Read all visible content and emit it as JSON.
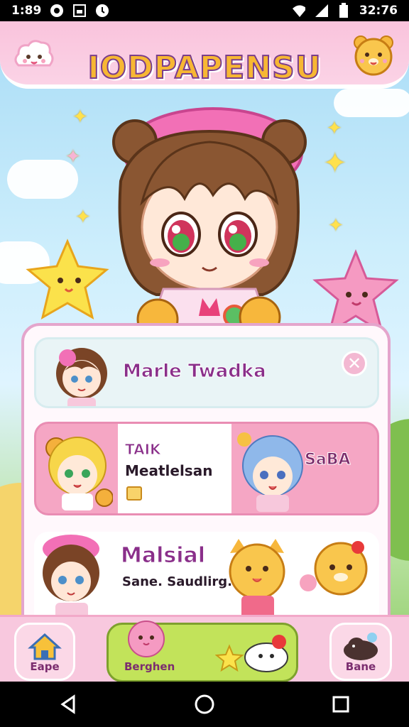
{
  "status_bar": {
    "time_left": "1:89",
    "time_right": "32:76"
  },
  "header": {
    "title": "IODPAPENSU"
  },
  "panel": {
    "row1": {
      "name": "Marle Twadka"
    },
    "row2": {
      "tag": "TAIK",
      "name": "Meatlelsan",
      "right_label": "SaBA"
    },
    "row3": {
      "title": "Malsial",
      "subtitle": "Sane. Saudlirg."
    }
  },
  "bottom_nav": {
    "left_label": "Eape",
    "center_label": "Berghen",
    "right_label": "Bane"
  },
  "colors": {
    "pink": "#f5a6c4",
    "purple": "#8a2f8a",
    "green": "#c2e35a"
  }
}
